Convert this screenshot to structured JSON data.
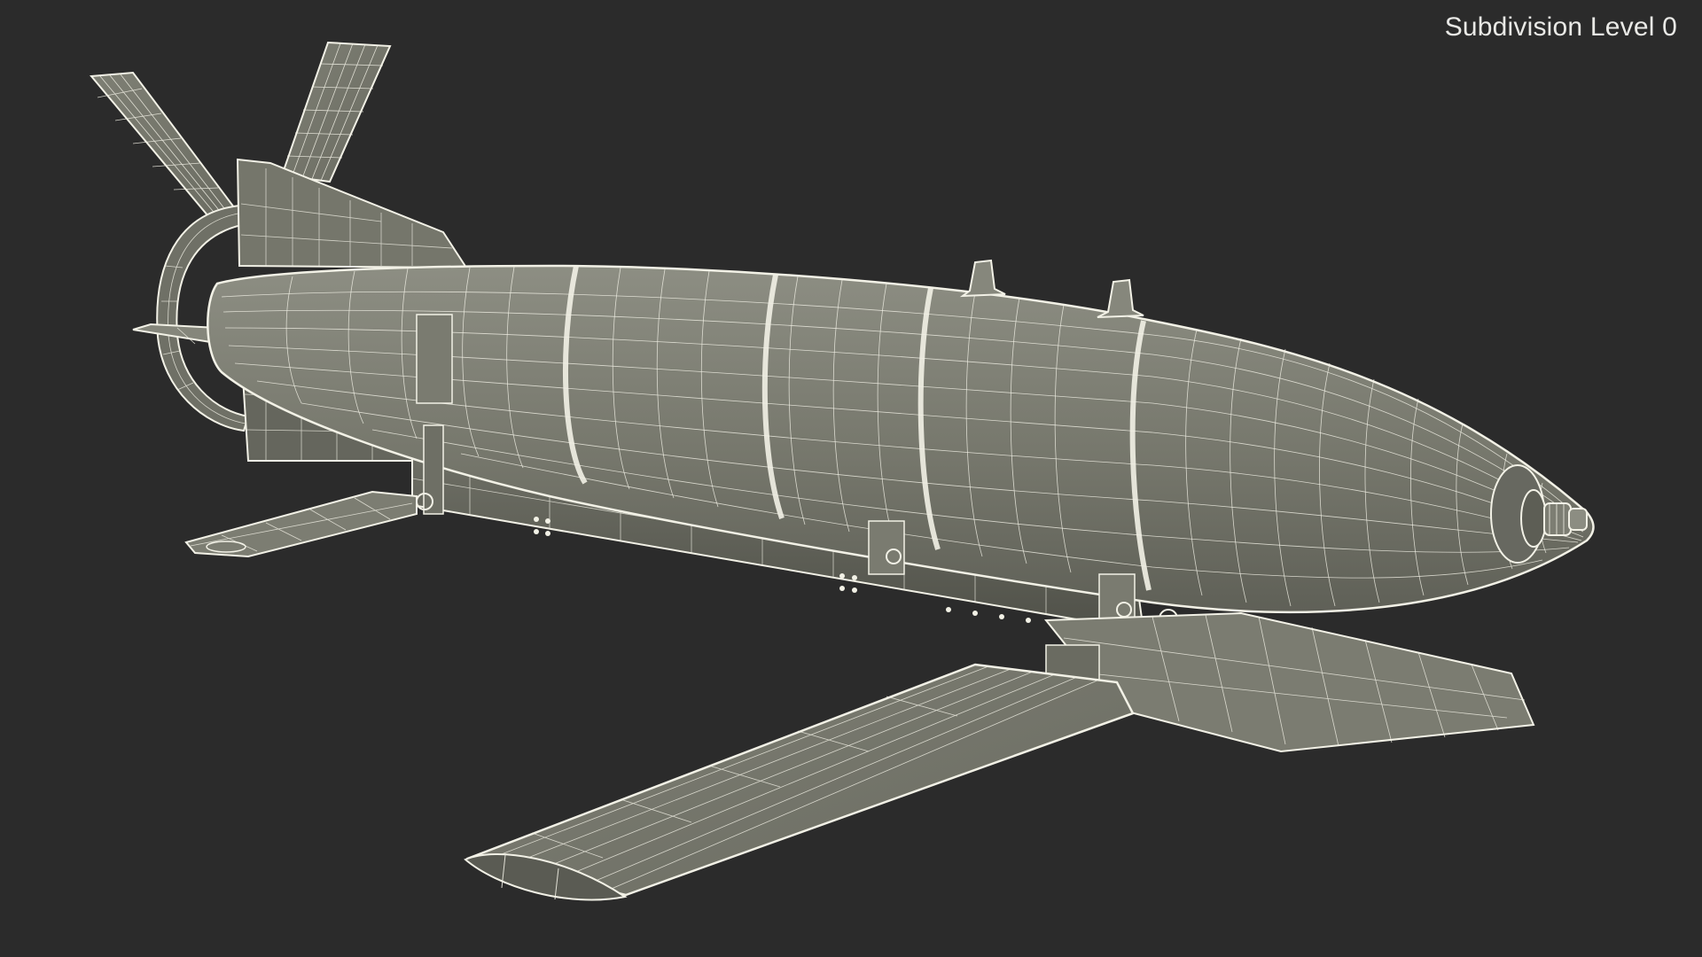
{
  "viewport": {
    "overlay_label": "Subdivision Level 0",
    "background_color": "#2b2b2b",
    "wire_color": "#f2f1e6",
    "surface_color": "#7d7e73"
  },
  "model": {
    "subject": "missile-with-wings-wireframe-render"
  }
}
